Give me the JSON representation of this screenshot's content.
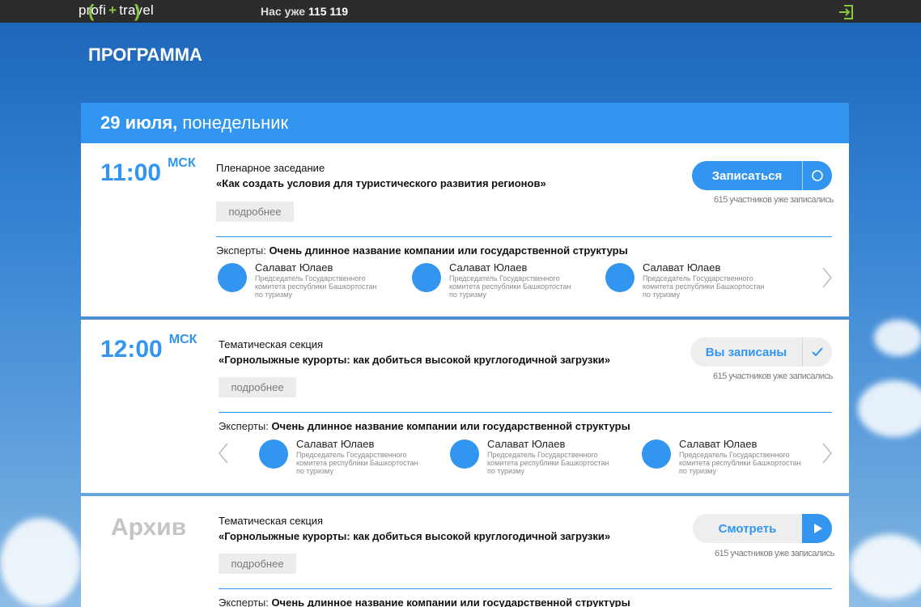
{
  "header": {
    "logo_left": "profi",
    "logo_plus": "+",
    "logo_right": "travel",
    "counter_prefix": "Нас уже",
    "counter_value": "115 119"
  },
  "page": {
    "title": "ПРОГРАММА"
  },
  "day": {
    "date": "29 июля,",
    "weekday": "понедельник"
  },
  "events": [
    {
      "time": "11:00",
      "tz": "МСК",
      "type": "Пленарное заседание",
      "title": "«Как создать условия для туристического развития регионов»",
      "more": "подробнее",
      "button": "Записаться",
      "count": "615 участников уже записались",
      "experts_label": "Эксперты:",
      "experts_org": "Очень длинное название компании или государственной структуры",
      "experts": [
        {
          "name": "Салават Юлаев",
          "role": "Председатель Государственного комитета республики Башкортостан по туризму"
        },
        {
          "name": "Салават Юлаев",
          "role": "Председатель Государственного комитета республики Башкортостан по туризму"
        },
        {
          "name": "Салават Юлаев",
          "role": "Председатель Государственного комитета республики Башкортостан по туризму"
        }
      ]
    },
    {
      "time": "12:00",
      "tz": "МСК",
      "type": "Тематическая секция",
      "title": "«Горнолыжные курорты: как добиться высокой круглогодичной загрузки»",
      "more": "подробнее",
      "button": "Вы записаны",
      "count": "615 участников уже записались",
      "experts_label": "Эксперты:",
      "experts_org": "Очень длинное название компании или государственной структуры",
      "experts": [
        {
          "name": "Салават Юлаев",
          "role": "Председатель Государственного комитета республики Башкортостан по туризму"
        },
        {
          "name": "Салават Юлаев",
          "role": "Председатель Государственного комитета республики Башкортостан по туризму"
        },
        {
          "name": "Салават Юлаев",
          "role": "Председатель Государственного комитета республики Башкортостан по туризму"
        }
      ]
    },
    {
      "time": "Архив",
      "type": "Тематическая секция",
      "title": "«Горнолыжные курорты: как добиться высокой круглогодичной загрузки»",
      "more": "подробнее",
      "button": "Смотреть",
      "count": "615 участников уже записались",
      "experts_label": "Эксперты:",
      "experts_org": "Очень длинное название компании или государственной структуры"
    }
  ],
  "colors": {
    "accent": "#3296f0",
    "topbar": "#2c2c2c",
    "logo_green": "#8cc63f",
    "muted": "#c4c4c4"
  },
  "icons": [
    "login-icon",
    "circle-icon",
    "check-icon",
    "play-icon",
    "chevron-left-icon",
    "chevron-right-icon"
  ]
}
